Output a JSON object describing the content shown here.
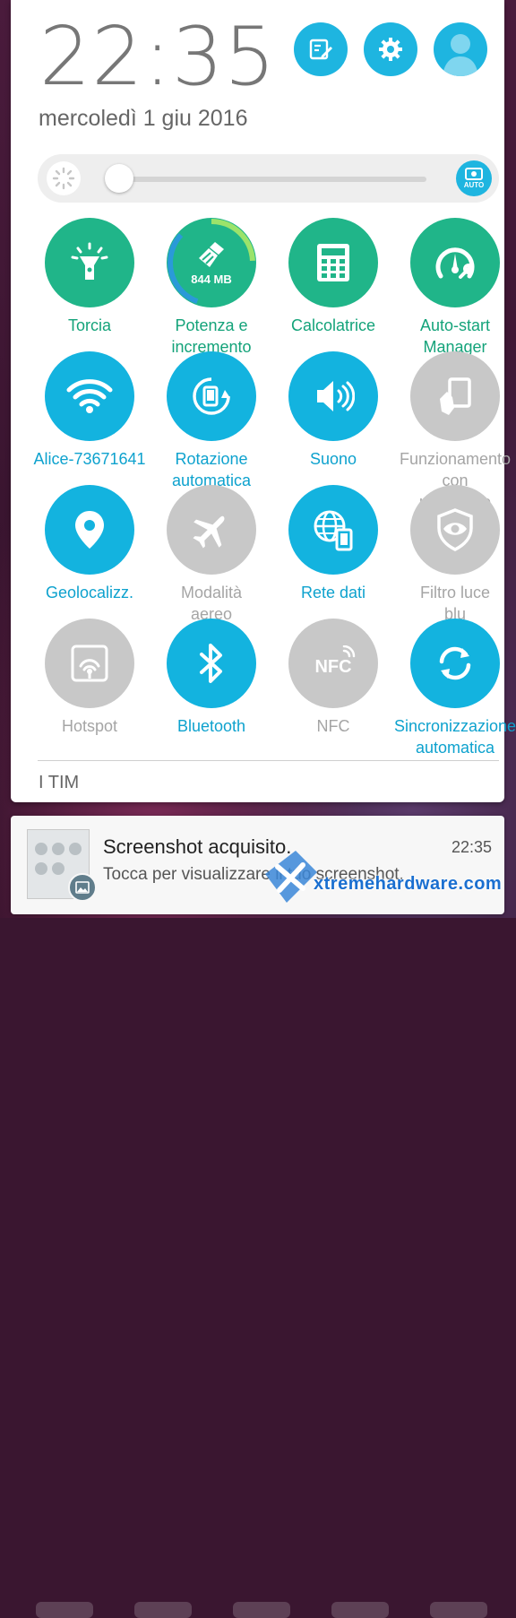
{
  "status": {
    "time": "22:35",
    "date": "mercoledì 1 giu 2016"
  },
  "header_buttons": [
    {
      "name": "edit-icon"
    },
    {
      "name": "gear-icon"
    },
    {
      "name": "user-avatar-icon"
    }
  ],
  "brightness": {
    "level": 0.03,
    "auto_label": "AUTO"
  },
  "tiles": [
    {
      "label": "Torcia",
      "style": "green",
      "icon": "flashlight-icon"
    },
    {
      "label": "Potenza e incremento",
      "style": "green",
      "icon": "broom-icon",
      "badge": "844 MB"
    },
    {
      "label": "Calcolatrice",
      "style": "green",
      "icon": "calculator-icon"
    },
    {
      "label": "Auto-start Manager",
      "style": "green",
      "icon": "gauge-wrench-icon"
    },
    {
      "label": "Alice-73671641",
      "style": "blue",
      "icon": "wifi-icon"
    },
    {
      "label": "Rotazione automatica",
      "style": "blue",
      "icon": "rotation-icon"
    },
    {
      "label": "Suono",
      "style": "blue",
      "icon": "speaker-icon"
    },
    {
      "label": "Funzionamento con una mano",
      "style": "grey",
      "icon": "one-hand-icon"
    },
    {
      "label": "Geolocalizz.",
      "style": "blue",
      "icon": "location-pin-icon"
    },
    {
      "label": "Modalità aereo",
      "style": "grey",
      "icon": "airplane-icon"
    },
    {
      "label": "Rete dati",
      "style": "blue",
      "icon": "globe-phone-icon"
    },
    {
      "label": "Filtro luce blu",
      "style": "grey",
      "icon": "eye-shield-icon"
    },
    {
      "label": "Hotspot",
      "style": "grey",
      "icon": "hotspot-icon"
    },
    {
      "label": "Bluetooth",
      "style": "blue",
      "icon": "bluetooth-icon"
    },
    {
      "label": "NFC",
      "style": "grey",
      "icon": "nfc-icon"
    },
    {
      "label": "Sincronizzazione automatica",
      "style": "blue",
      "icon": "sync-icon"
    }
  ],
  "carrier": "I TIM",
  "notification": {
    "title": "Screenshot acquisito.",
    "time": "22:35",
    "text": "Tocca per visualizzare il tuo screenshot."
  },
  "watermark": {
    "text": "xtremehardware.com"
  },
  "colors": {
    "green": "#20b589",
    "blue": "#13b3df",
    "grey": "#c8c8c8",
    "accent": "#1eb5e0"
  }
}
